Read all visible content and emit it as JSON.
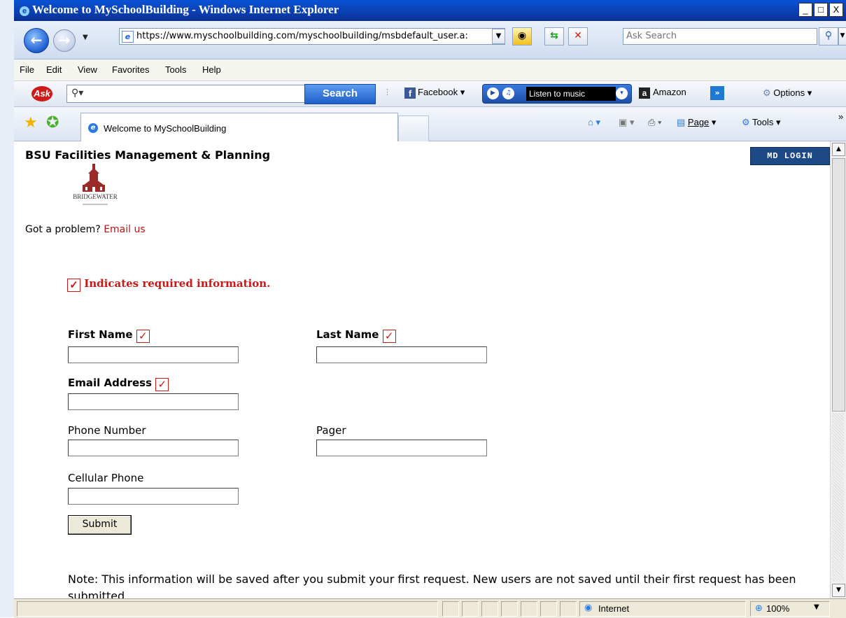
{
  "window": {
    "title": "Welcome to MySchoolBuilding - Windows Internet Explorer",
    "buttons": [
      "_",
      "□",
      "X"
    ]
  },
  "address": {
    "url": "https://www.myschoolbuilding.com/myschoolbuilding/msbdefault_user.a:",
    "search_placeholder": "Ask Search"
  },
  "menu": {
    "items": [
      "File",
      "Edit",
      "View",
      "Favorites",
      "Tools",
      "Help"
    ]
  },
  "toolbar": {
    "ask_logo": "Ask",
    "search_button": "Search",
    "facebook": "Facebook",
    "music": "Listen to music",
    "amazon": "Amazon",
    "options": "Options"
  },
  "tabs": {
    "active": "Welcome to MySchoolBuilding"
  },
  "commandbar": {
    "page": "Page",
    "tools": "Tools"
  },
  "page": {
    "org_title": "BSU Facilities Management & Planning",
    "md_login": "MD LOGIN",
    "logo_text": "BRIDGEWATER",
    "problem_prefix": "Got a problem?",
    "email_link": "Email us",
    "required_note": "Indicates required information.",
    "check_glyph": "✓",
    "fields": {
      "first_name": "First Name",
      "last_name": "Last Name",
      "email": "Email Address",
      "phone": "Phone Number",
      "pager": "Pager",
      "cellular": "Cellular Phone"
    },
    "submit": "Submit",
    "note": "Note: This information will be saved after you submit your first request. New users are not saved until their first request has been submitted."
  },
  "status": {
    "zone": "Internet",
    "zoom": "100%"
  },
  "colors": {
    "required_red": "#c81818",
    "link_red": "#b81414",
    "titlebar_blue": "#0a52d6",
    "md_login_bg": "#1d4a86"
  }
}
